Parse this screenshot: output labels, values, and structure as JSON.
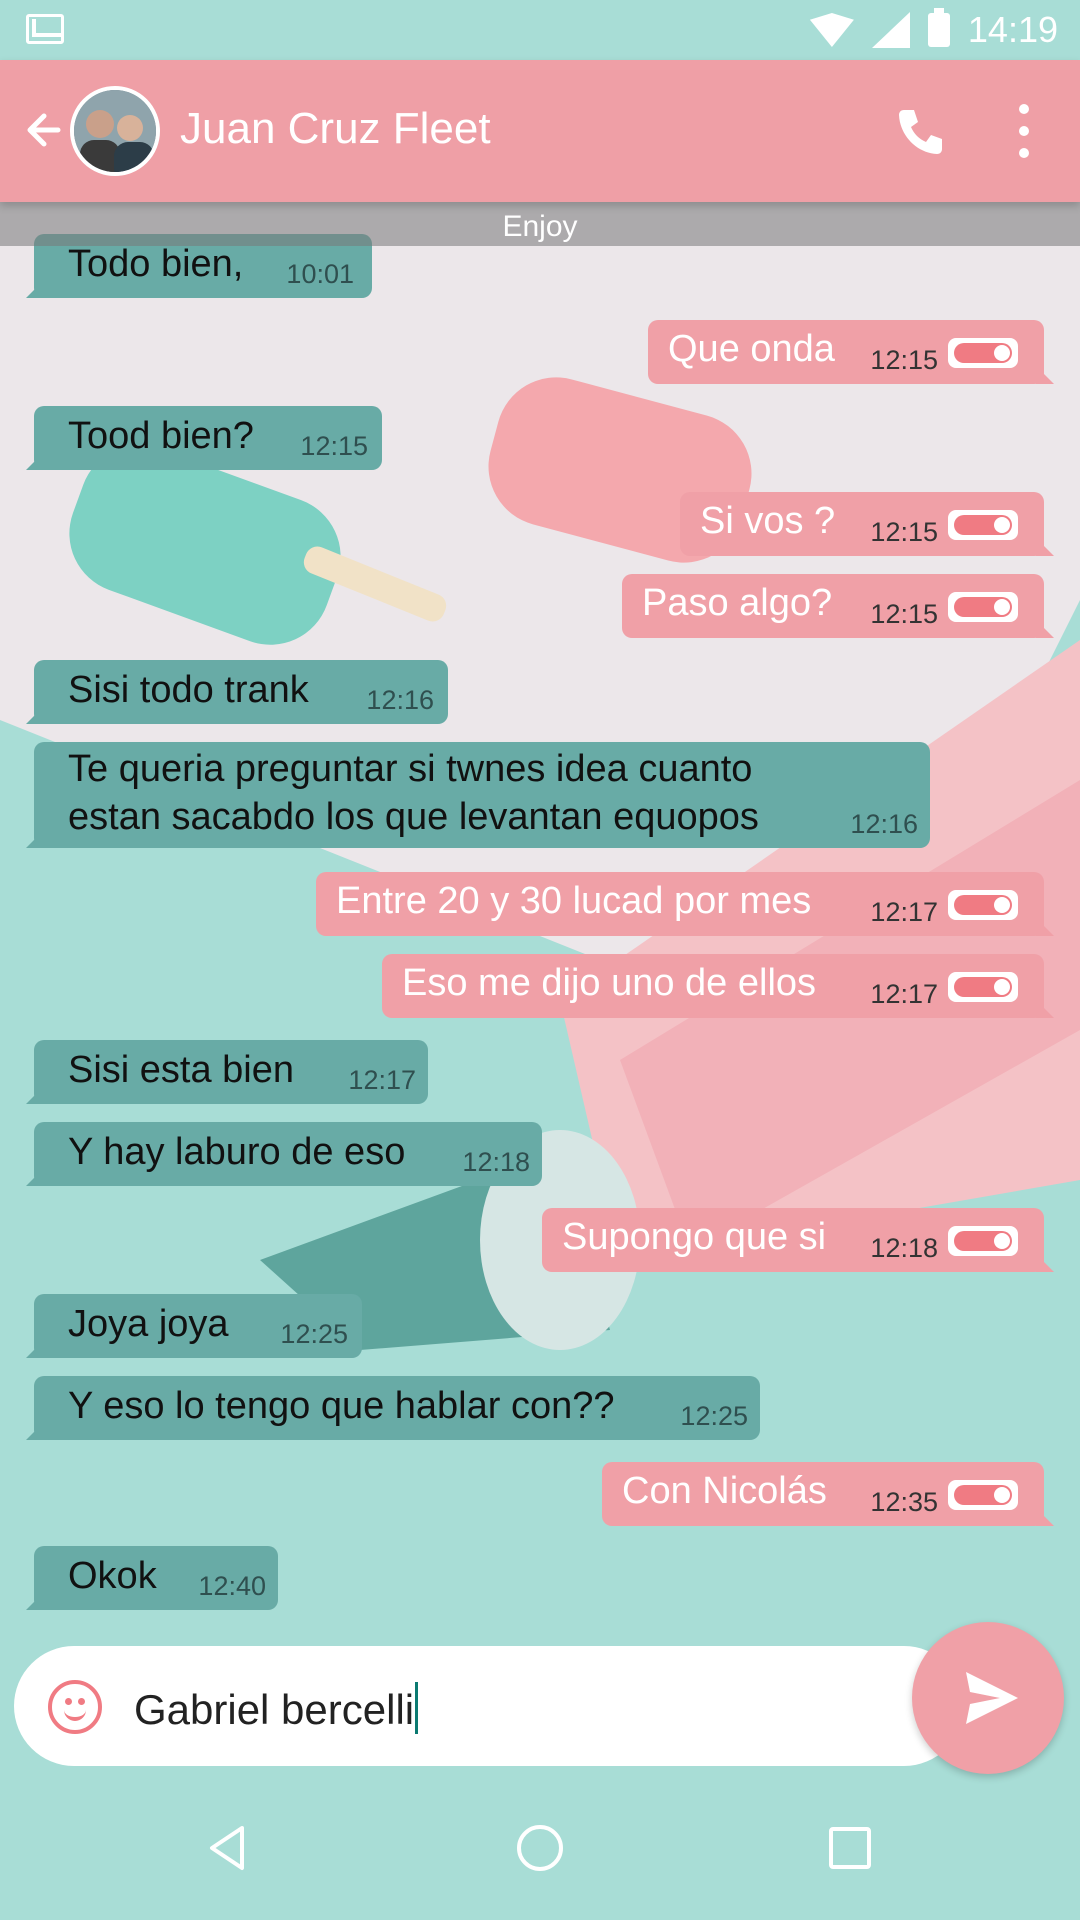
{
  "status_bar": {
    "time": "14:19"
  },
  "header": {
    "contact_name": "Juan Cruz Fleet"
  },
  "date_banner": "Enjoy",
  "messages": [
    {
      "dir": "in",
      "text": "Todo bien,",
      "time": "10:01"
    },
    {
      "dir": "out",
      "text": "Que onda",
      "time": "12:15"
    },
    {
      "dir": "in",
      "text": "Tood bien?",
      "time": "12:15"
    },
    {
      "dir": "out",
      "text": "Si vos ?",
      "time": "12:15"
    },
    {
      "dir": "out",
      "text": "Paso algo?",
      "time": "12:15"
    },
    {
      "dir": "in",
      "text": "Sisi todo trank",
      "time": "12:16"
    },
    {
      "dir": "in",
      "line1": "Te queria preguntar si twnes idea cuanto",
      "line2": "estan sacabdo los que levantan equopos",
      "time": "12:16"
    },
    {
      "dir": "out",
      "text": "Entre 20 y 30 lucad por mes",
      "time": "12:17"
    },
    {
      "dir": "out",
      "text": "Eso me dijo uno de ellos",
      "time": "12:17"
    },
    {
      "dir": "in",
      "text": "Sisi esta bien",
      "time": "12:17"
    },
    {
      "dir": "in",
      "text": "Y hay laburo de eso",
      "time": "12:18"
    },
    {
      "dir": "out",
      "text": "Supongo que si",
      "time": "12:18"
    },
    {
      "dir": "in",
      "text": "Joya joya",
      "time": "12:25"
    },
    {
      "dir": "in",
      "text": "Y eso lo tengo que hablar con??",
      "time": "12:25"
    },
    {
      "dir": "out",
      "text": "Con Nicolás",
      "time": "12:35"
    },
    {
      "dir": "in",
      "text": "Okok",
      "time": "12:40"
    }
  ],
  "composer": {
    "value": "Gabriel bercelli"
  },
  "colors": {
    "accent": "#ef9fa6",
    "incoming_bubble": "#68aba6",
    "outgoing_bubble": "#f0a0a7",
    "background": "#a8ddd6"
  },
  "icons": {
    "back": "arrow-left-icon",
    "call": "phone-icon",
    "more": "more-vert-icon",
    "emoji": "emoji-icon",
    "send": "send-icon",
    "nav_back": "triangle-back-icon",
    "nav_home": "circle-home-icon",
    "nav_recents": "square-recents-icon"
  }
}
